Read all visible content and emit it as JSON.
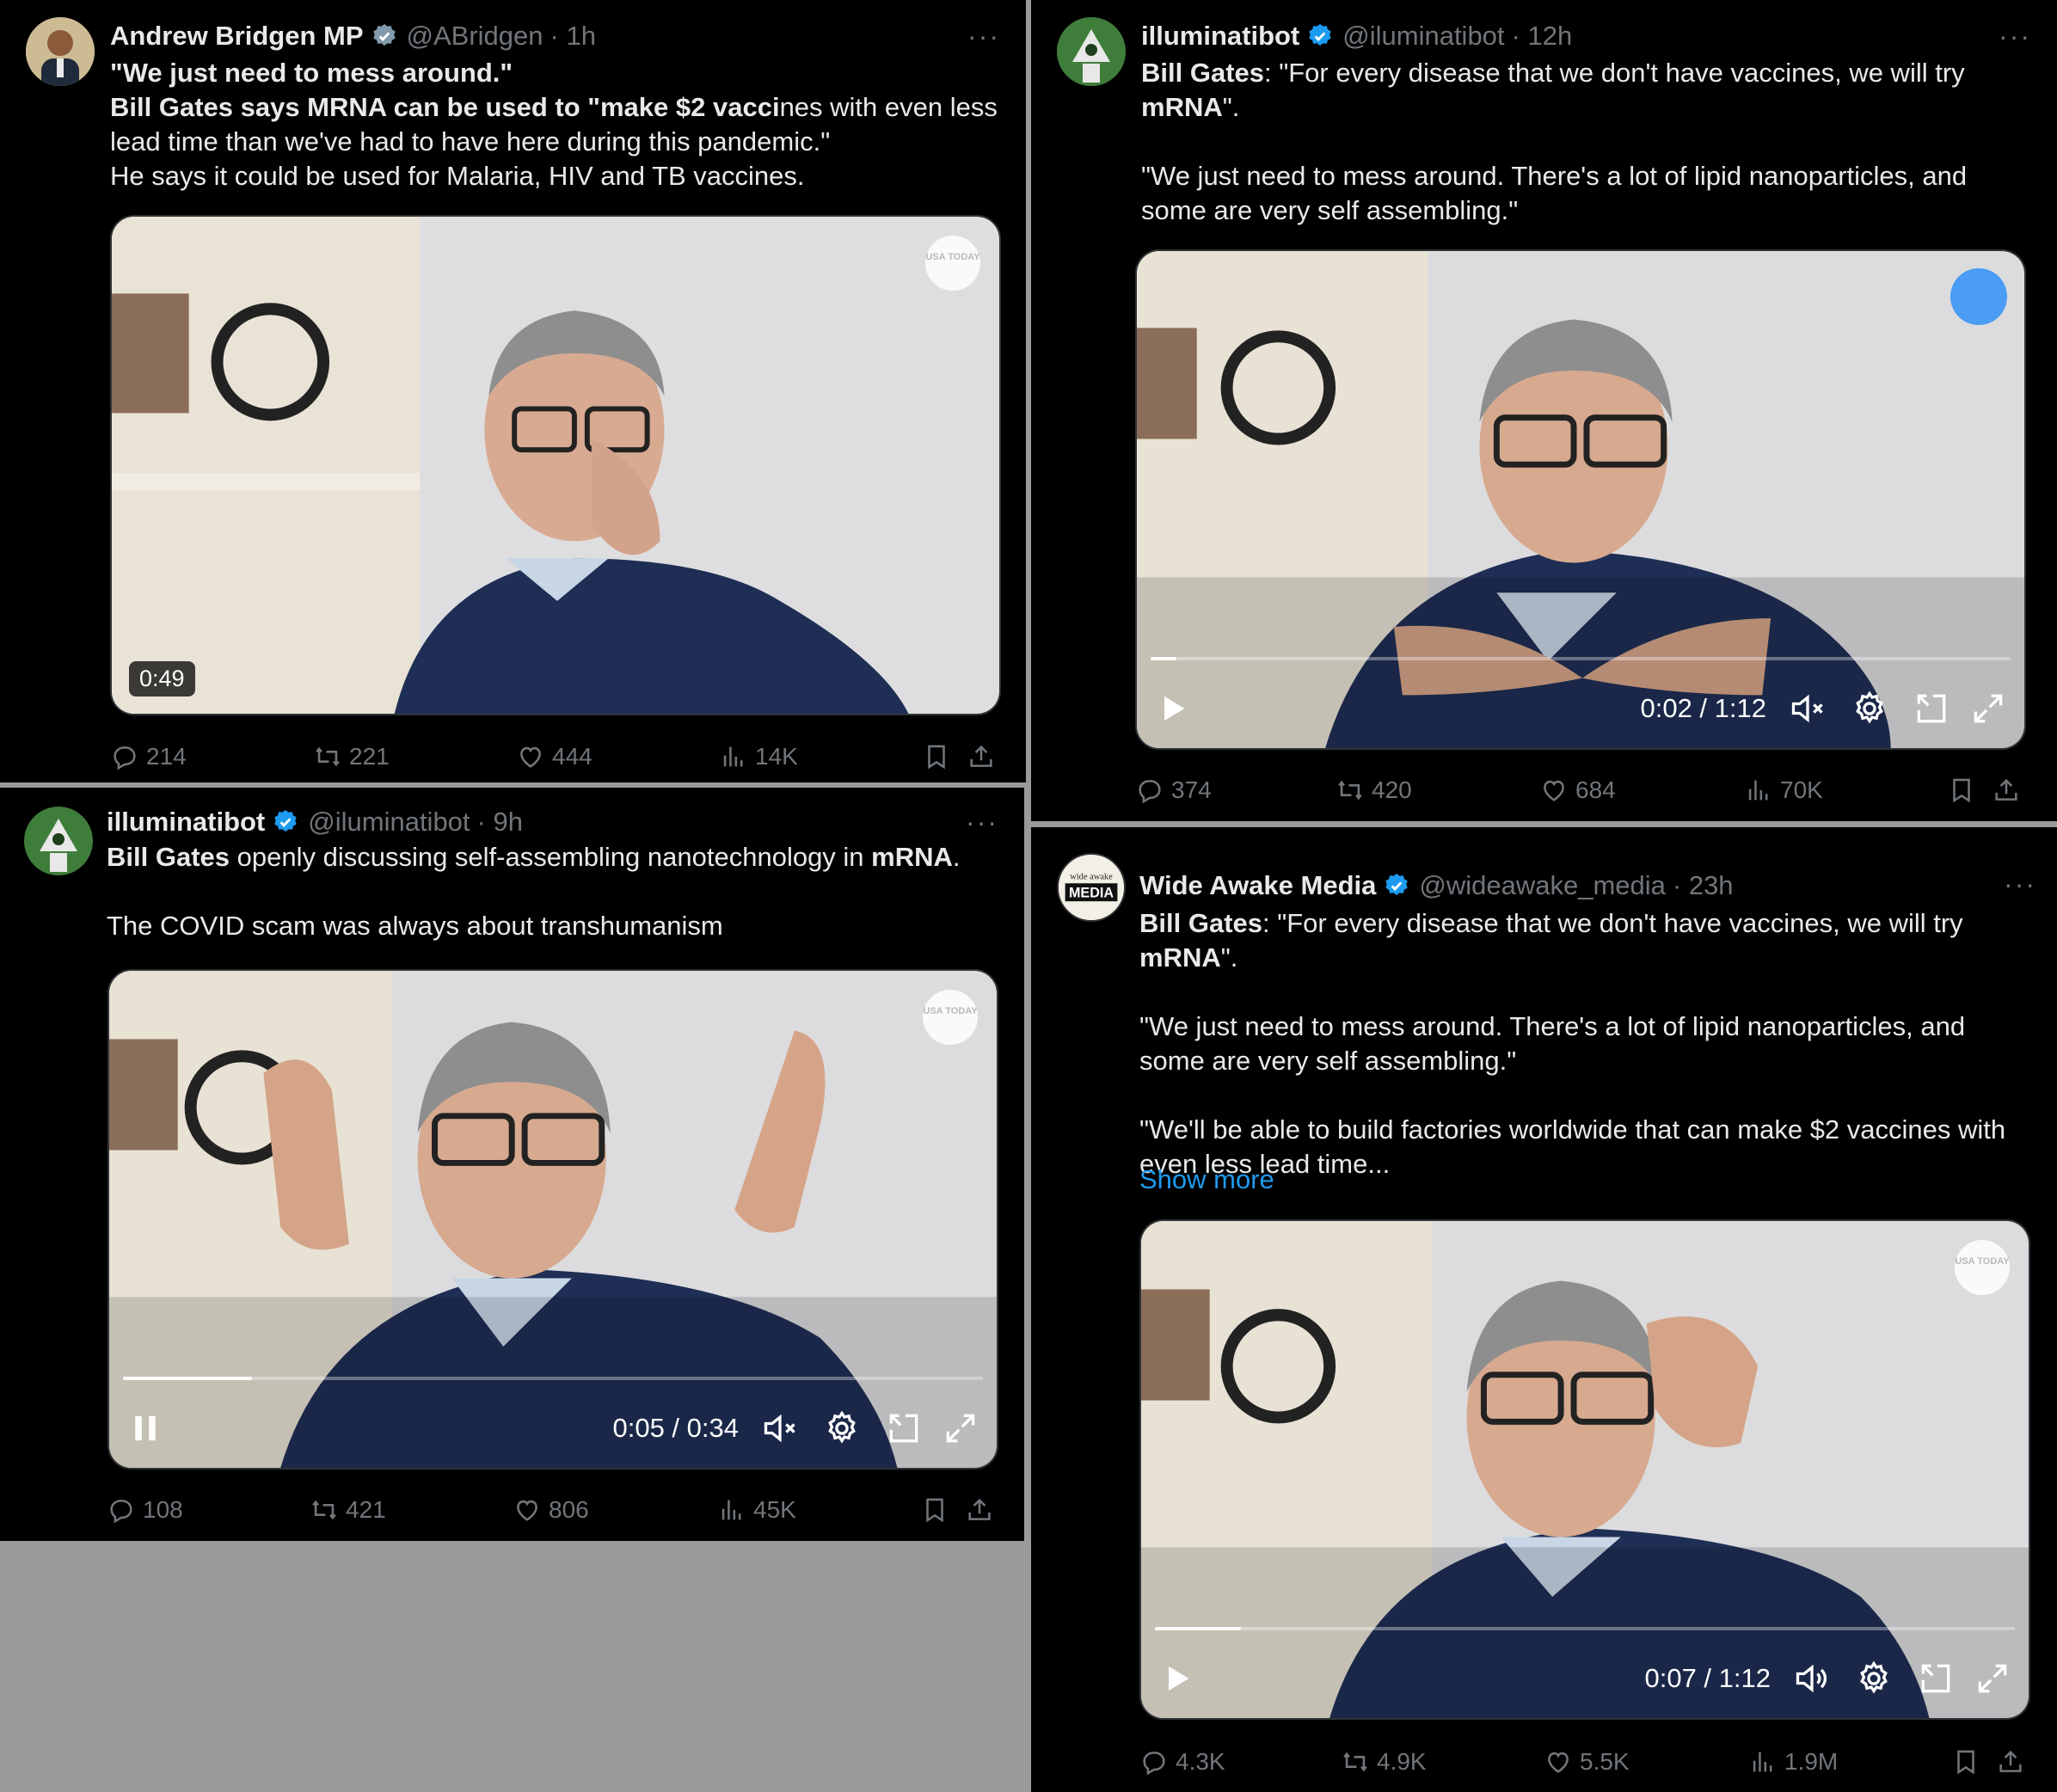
{
  "tweets": [
    {
      "name": "Andrew Bridgen MP",
      "handle": "@ABridgen",
      "time": "· 1h",
      "lines": [
        {
          "segments": [
            {
              "t": "\"We just need to mess around.\"",
              "b": true
            }
          ]
        },
        {
          "segments": [
            {
              "t": "Bill Gates says MRNA can be used to \"make $2 vacci",
              "b": true
            },
            {
              "t": "nes with even less",
              "b": false
            }
          ]
        },
        {
          "segments": [
            {
              "t": "lead time than we've had to have here during this pandemic.\"",
              "b": false
            }
          ]
        },
        {
          "segments": [
            {
              "t": "He says it could be used for Malaria, HIV and TB vaccines.",
              "b": false
            }
          ]
        }
      ],
      "video": {
        "duration": "0:49",
        "logo": "USA TODAY"
      },
      "stats": {
        "replies": "214",
        "retweets": "221",
        "likes": "444",
        "views": "14K"
      }
    },
    {
      "name": "illuminatibot",
      "handle": "@iluminatibot",
      "time": "· 12h",
      "paras": [
        {
          "segments": [
            {
              "t": "Bill Gates",
              "b": true
            },
            {
              "t": ": \"For every disease that we don't have vaccines, we will try ",
              "b": false
            },
            {
              "t": "mRNA",
              "b": true
            },
            {
              "t": "\".",
              "b": false
            }
          ]
        },
        {
          "segments": [
            {
              "t": "\"We just need to mess around. There's a lot of lipid nanoparticles, and some are very self assembling.\"",
              "b": false
            }
          ]
        }
      ],
      "video": {
        "time": "0:02 / 1:12",
        "progress": 0.03
      },
      "stats": {
        "replies": "374",
        "retweets": "420",
        "likes": "684",
        "views": "70K"
      }
    },
    {
      "name": "illuminatibot",
      "handle": "@iluminatibot",
      "time": "· 9h",
      "paras": [
        {
          "segments": [
            {
              "t": "Bill Gates",
              "b": true
            },
            {
              "t": " openly discussing self-assembling nanotechnology in ",
              "b": false
            },
            {
              "t": "mRNA",
              "b": true
            },
            {
              "t": ".",
              "b": false
            }
          ]
        },
        {
          "segments": [
            {
              "t": "The COVID scam was always about transhumanism",
              "b": false
            }
          ]
        }
      ],
      "video": {
        "time": "0:05 / 0:34",
        "progress": 0.15,
        "logo": "USA TODAY"
      },
      "stats": {
        "replies": "108",
        "retweets": "421",
        "likes": "806",
        "views": "45K"
      }
    },
    {
      "name": "Wide Awake Media",
      "handle": "@wideawake_media",
      "time": "· 23h",
      "avatar_text": [
        "wide awake",
        "MEDIA"
      ],
      "paras": [
        {
          "segments": [
            {
              "t": "Bill Gates",
              "b": true
            },
            {
              "t": ": \"For every disease that we don't have vaccines, we will try ",
              "b": false
            },
            {
              "t": "mRNA",
              "b": true
            },
            {
              "t": "\".",
              "b": false
            }
          ]
        },
        {
          "segments": [
            {
              "t": "\"We just need to mess around. There's a lot of lipid nanoparticles, and some are very self assembling.\"",
              "b": false
            }
          ]
        },
        {
          "segments": [
            {
              "t": "\"We'll be able to build factories worldwide that can make $2 vaccines with even less lead time...",
              "b": false
            }
          ]
        }
      ],
      "show_more": "Show more",
      "video": {
        "time": "0:07 / 1:12",
        "progress": 0.1,
        "logo": "USA TODAY"
      },
      "stats": {
        "replies": "4.3K",
        "retweets": "4.9K",
        "likes": "5.5K",
        "views": "1.9M"
      }
    }
  ],
  "icons": {
    "more": "more-icon",
    "verified": "verified-badge-icon",
    "reply": "reply-icon",
    "retweet": "retweet-icon",
    "like": "like-icon",
    "views": "views-icon",
    "bookmark": "bookmark-icon",
    "share": "share-icon",
    "play": "play-icon",
    "pause": "pause-icon",
    "mute": "mute-icon",
    "volume": "volume-icon",
    "settings": "gear-icon",
    "pip": "pip-icon",
    "fullscreen": "fullscreen-icon"
  },
  "colors": {
    "background": "#000000",
    "text": "#e7e9ea",
    "muted": "#71767b",
    "accent": "#1d9bf0"
  }
}
